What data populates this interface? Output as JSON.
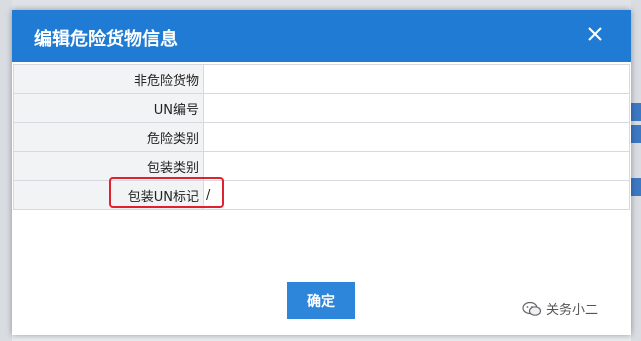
{
  "modal": {
    "title": "编辑危险货物信息",
    "close_label": "×"
  },
  "form": {
    "rows": [
      {
        "label": "非危险货物",
        "value": ""
      },
      {
        "label": "UN编号",
        "value": ""
      },
      {
        "label": "危险类别",
        "value": ""
      },
      {
        "label": "包装类别",
        "value": ""
      },
      {
        "label": "包装UN标记",
        "value": "/"
      }
    ]
  },
  "buttons": {
    "confirm_label": "确定"
  },
  "watermark": {
    "text": "关务小二"
  },
  "colors": {
    "header": "#1f7bd3",
    "button": "#2e86db",
    "highlight": "#e0212e"
  }
}
